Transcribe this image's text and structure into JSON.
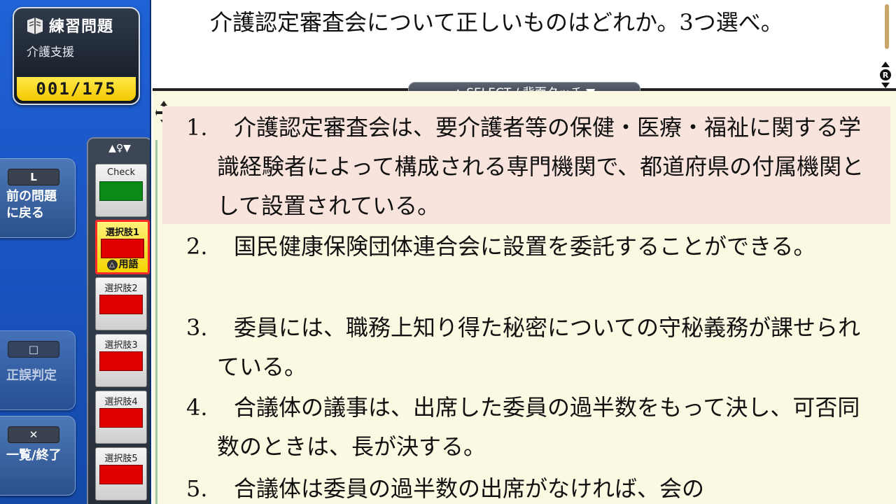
{
  "app": {
    "title": "練習問題",
    "subject": "介護支援",
    "counter": "001/175"
  },
  "sidebar": {
    "prev": {
      "key": "L",
      "label": "前の問題\nに戻る"
    },
    "judge": {
      "key": "□",
      "label": "正誤判定"
    },
    "list": {
      "key": "✕",
      "label": "一覧/終了"
    }
  },
  "choice_panel": {
    "header": "▲♀▼",
    "check_label": "Check",
    "chips": [
      "選択肢1",
      "選択肢2",
      "選択肢3",
      "選択肢4",
      "選択肢5"
    ],
    "term_label": "用語",
    "term_key": "△"
  },
  "question": {
    "text": "介護認定審査会について正しいものはどれか。3つ選べ。"
  },
  "select_tab": "▲ SELECT / 背面タッチ ▼",
  "choices": [
    {
      "num": "1.",
      "text": "介護認定審査会は、要介護者等の保健・医療・福祉に関する学識経験者によって構成される専門機関で、都道府県の付属機関として設置されている。"
    },
    {
      "num": "2.",
      "text": "国民健康保険団体連合会に設置を委託することができる。"
    },
    {
      "num": "3.",
      "text": "委員には、職務上知り得た秘密についての守秘義務が課せられている。"
    },
    {
      "num": "4.",
      "text": "合議体の議事は、出席した委員の過半数をもって決し、可否同数のときは、長が決する。"
    },
    {
      "num": "5.",
      "text": "合議体は委員の過半数の出席がなければ、会の"
    }
  ],
  "colors": {
    "sidebar_blue": "#1a55c4",
    "counter_yellow": "#f3c800",
    "choice_highlight": "#f8e4dc",
    "answer_bg": "#fcf9e2"
  }
}
